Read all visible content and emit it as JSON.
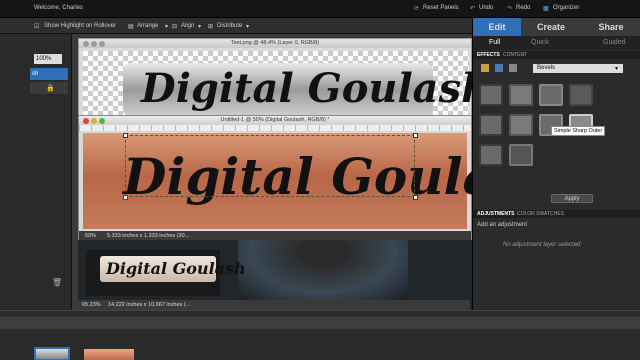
{
  "topbar": {
    "welcome": "Welcome, Charles",
    "reset_panels": "Reset Panels",
    "undo": "Undo",
    "redo": "Redo",
    "organizer": "Organizer"
  },
  "options": {
    "show_highlight": "Show Highlight on Rollover",
    "arrange": "Arrange",
    "align": "Align",
    "distribute": "Distribute"
  },
  "left_panel": {
    "zoom": "100%",
    "layer_label": "sh"
  },
  "doc_back": {
    "title": "Test.png @ 48.4% (Layer 0, RGB/8)",
    "text": "Digital Goulash"
  },
  "doc_front": {
    "title": "Untitled-1 @ 50% (Digital Goulash, RGB/8) *",
    "text": "Digital Goulash",
    "zoom": "50%",
    "size": "5.333 inches x 1.333 inches (30..."
  },
  "doc_photo": {
    "text": "Digital Goulash",
    "zoom": "65.23%",
    "size": "14.222 inches x 10.667 inches (..."
  },
  "right_panel": {
    "tabs": [
      "Edit",
      "Create",
      "Share"
    ],
    "subtabs": [
      "Full",
      "Quick",
      "Guided"
    ],
    "effects_tabs": [
      "EFFECTS",
      "CONTENT"
    ],
    "effects_dropdown": "Bevels",
    "tooltip": "Simple Sharp Outer",
    "apply": "Apply",
    "adjust_tabs": [
      "ADJUSTMENTS",
      "COLOR SWATCHES"
    ],
    "add_adjustment": "Add an adjustment",
    "no_layer": "No adjustment layer selected"
  },
  "colors": {
    "accent_blue": "#2f6fb8",
    "copper": "#c07050"
  }
}
